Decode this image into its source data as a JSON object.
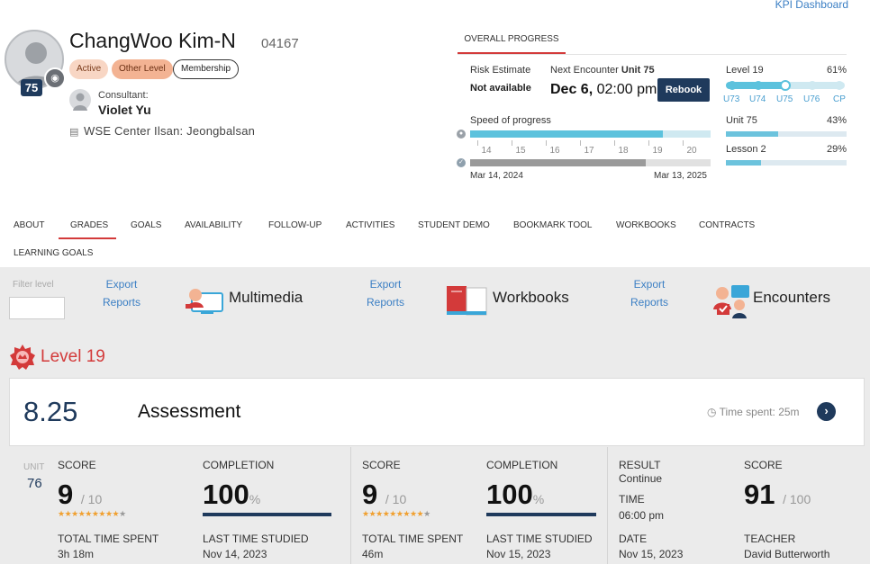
{
  "header": {
    "kpi_link": "KPI Dashboard",
    "student_name": "ChangWoo Kim-N",
    "student_id": "04167",
    "level_badge": "75",
    "tags": [
      "Active",
      "Other Level",
      "Membership"
    ],
    "consultant_label": "Consultant:",
    "consultant_name": "Violet Yu",
    "center": "WSE Center Ilsan: Jeongbalsan"
  },
  "overall": {
    "tab": "OVERALL PROGRESS",
    "risk_label": "Risk Estimate",
    "risk_value": "Not available",
    "next_label": "Next Encounter",
    "next_unit": "Unit 75",
    "next_date": "Dec 6,",
    "next_time": "02:00 pm",
    "rebook": "Rebook",
    "speed_label": "Speed of progress",
    "speed_fill": 0.8,
    "time_fill": 0.73,
    "ticks": [
      "14",
      "15",
      "16",
      "17",
      "18",
      "19",
      "20"
    ],
    "start_date": "Mar 14, 2024",
    "end_date": "Mar 13, 2025",
    "level_label": "Level 19",
    "level_pct": "61%",
    "units": [
      "U73",
      "U74",
      "U75",
      "U76",
      "CP"
    ],
    "unit_label": "Unit 75",
    "unit_pct": "43%",
    "unit_fill": 0.43,
    "lesson_label": "Lesson 2",
    "lesson_pct": "29%",
    "lesson_fill": 0.29
  },
  "tabs": [
    "ABOUT",
    "GRADES",
    "GOALS",
    "AVAILABILITY",
    "FOLLOW-UP",
    "ACTIVITIES",
    "STUDENT DEMO",
    "BOOKMARK TOOL",
    "WORKBOOKS",
    "CONTRACTS",
    "LEARNING GOALS"
  ],
  "filters": {
    "filter_label": "Filter level",
    "export": "Export",
    "reports": "Reports",
    "multimedia": "Multimedia",
    "workbooks": "Workbooks",
    "encounters": "Encounters"
  },
  "level": {
    "title": "Level 19"
  },
  "assessment": {
    "score": "8.25",
    "title": "Assessment",
    "time_spent": "Time spent: 25m"
  },
  "unit_section": {
    "unit_label": "UNIT",
    "unit_number": "76",
    "score_label": "SCORE",
    "completion_label": "COMPLETION",
    "total_time_label": "TOTAL TIME SPENT",
    "last_studied_label": "LAST TIME STUDIED",
    "mm": {
      "score": "9",
      "score_max": "/ 10",
      "completion": "100",
      "pct": "%",
      "total_time": "3h 18m",
      "last_studied": "Nov 14, 2023"
    },
    "wb": {
      "score": "9",
      "score_max": "/ 10",
      "completion": "100",
      "pct": "%",
      "total_time": "46m",
      "last_studied": "Nov 15, 2023"
    },
    "enc": {
      "result_label": "RESULT",
      "result": "Continue",
      "time_label": "TIME",
      "time": "06:00 pm",
      "date_label": "DATE",
      "date": "Nov 15, 2023",
      "score_label": "SCORE",
      "score": "91",
      "score_max": "/ 100",
      "teacher_label": "TEACHER",
      "teacher": "David Butterworth"
    },
    "stars": "★★★★★★★★★",
    "star_empty": "★"
  },
  "colors": {
    "accent_red": "#d33a3a",
    "navy": "#1f3a5c",
    "progress_blue": "#5cc2dd"
  }
}
